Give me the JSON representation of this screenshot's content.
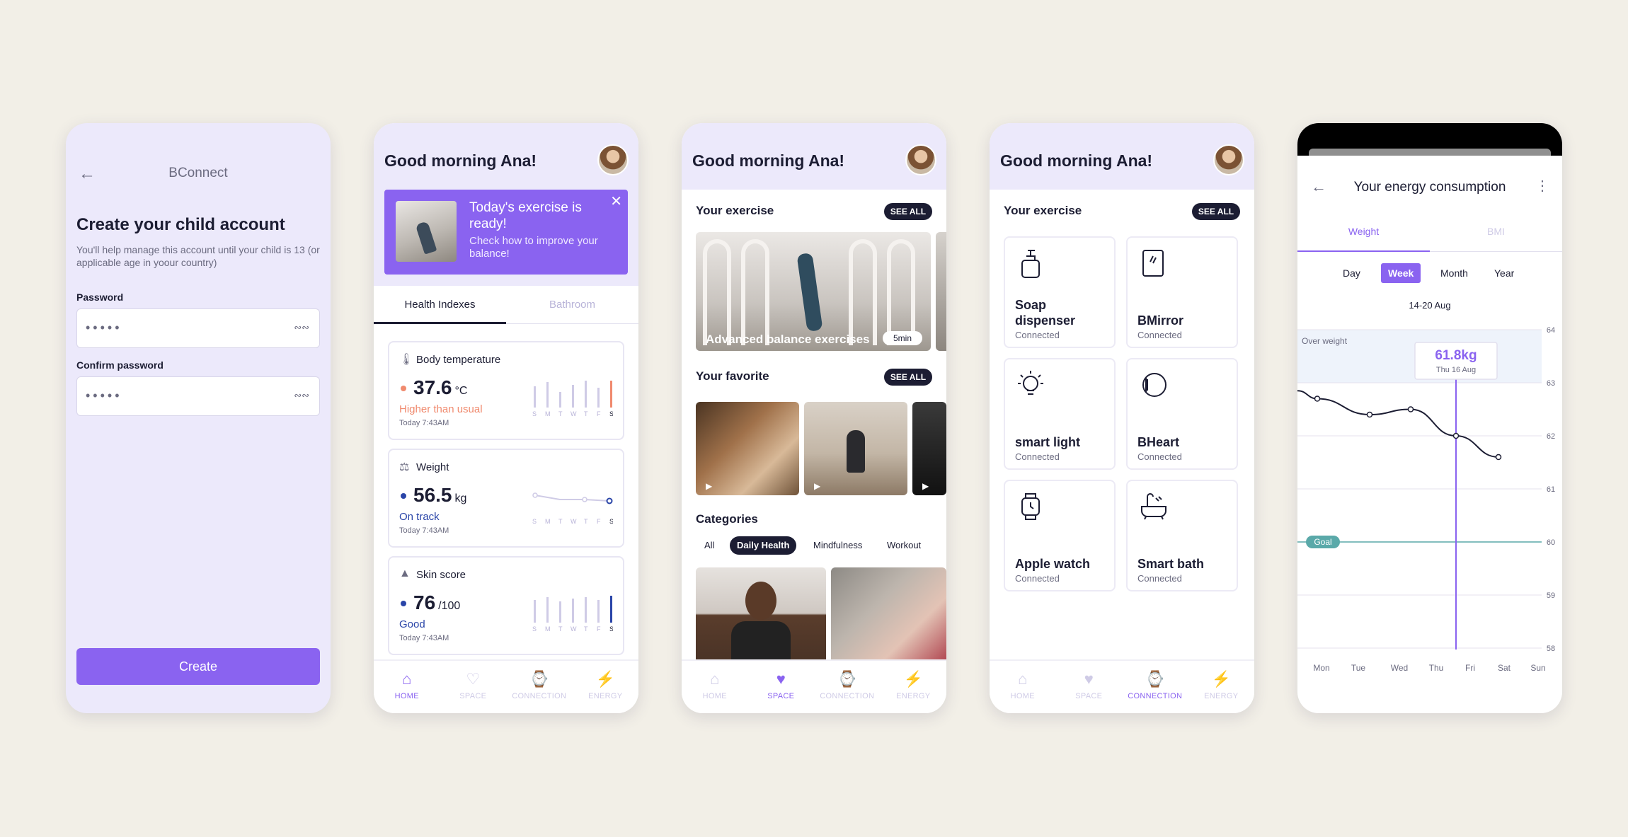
{
  "screen1": {
    "title": "BConnect",
    "heading": "Create your child account",
    "subtitle": "You'll help manage this account until your child is 13 (or applicable age in yoour country)",
    "password_label": "Password",
    "password_value": "•••••",
    "confirm_label": "Confirm password",
    "confirm_value": "•••••",
    "create_label": "Create"
  },
  "greeting": "Good morning Ana!",
  "screen2": {
    "banner_title": "Today's exercise is ready!",
    "banner_sub": "Check how to improve your balance!",
    "tabs": [
      "Health Indexes",
      "Bathroom"
    ],
    "cards": [
      {
        "title": "Body temperature",
        "value": "37.6",
        "unit": "°C",
        "status": "Higher than usual",
        "time": "Today 7:43AM",
        "status_color": "#f08a6e",
        "dot": "#f08a6e"
      },
      {
        "title": "Weight",
        "value": "56.5",
        "unit": "kg",
        "status": "On track",
        "time": "Today 7:43AM",
        "status_color": "#2a45a8",
        "dot": "#2a45a8"
      },
      {
        "title": "Skin score",
        "value": "76",
        "unit": "/100",
        "status": "Good",
        "time": "Today 7:43AM",
        "status_color": "#2a45a8",
        "dot": "#2a45a8"
      }
    ],
    "days": [
      "S",
      "M",
      "T",
      "W",
      "T",
      "F",
      "S"
    ]
  },
  "nav": [
    "HOME",
    "SPACE",
    "CONNECTION",
    "ENERGY"
  ],
  "screen3": {
    "exercise_title": "Your exercise",
    "see_all": "SEE ALL",
    "exercise_caption": "Advanced balance exercises",
    "exercise_duration": "5min",
    "favorite_title": "Your favorite",
    "categories_title": "Categories",
    "categories": [
      "All",
      "Daily Health",
      "Mindfulness",
      "Workout"
    ]
  },
  "screen4": {
    "exercise_title": "Your exercise",
    "see_all": "SEE ALL",
    "devices": [
      {
        "name": "Soap dispenser",
        "status": "Connected"
      },
      {
        "name": "BMirror",
        "status": "Connected"
      },
      {
        "name": "smart light",
        "status": "Connected"
      },
      {
        "name": "BHeart",
        "status": "Connected"
      },
      {
        "name": "Apple watch",
        "status": "Connected"
      },
      {
        "name": "Smart bath",
        "status": "Connected"
      }
    ]
  },
  "screen5": {
    "title": "Your energy consumption",
    "tabs": [
      "Weight",
      "BMI"
    ],
    "periods": [
      "Day",
      "Week",
      "Month",
      "Year"
    ],
    "range": "14-20 Aug",
    "overweight_label": "Over weight",
    "goal_label": "Goal",
    "tooltip_value": "61.8kg",
    "tooltip_date": "Thu 16 Aug"
  },
  "colors": {
    "accent": "#8a63f0",
    "dark": "#1c1d33",
    "lavender": "#ece9fb",
    "alert": "#f08a6e",
    "track": "#2a45a8",
    "goal": "#5aa9a9"
  },
  "chart_data": {
    "type": "line",
    "x": [
      "Mon",
      "Tue",
      "Wed",
      "Thu",
      "Fri",
      "Sat",
      "Sun"
    ],
    "series": [
      {
        "values": [
          62.7,
          62.4,
          62.5,
          62.0,
          61.6,
          null,
          null
        ]
      }
    ],
    "ylim": [
      58,
      64
    ],
    "yticks": [
      58,
      59,
      60,
      61,
      62,
      63,
      64
    ],
    "goal": 60,
    "overweight_band": [
      63,
      64
    ],
    "grid": true
  }
}
